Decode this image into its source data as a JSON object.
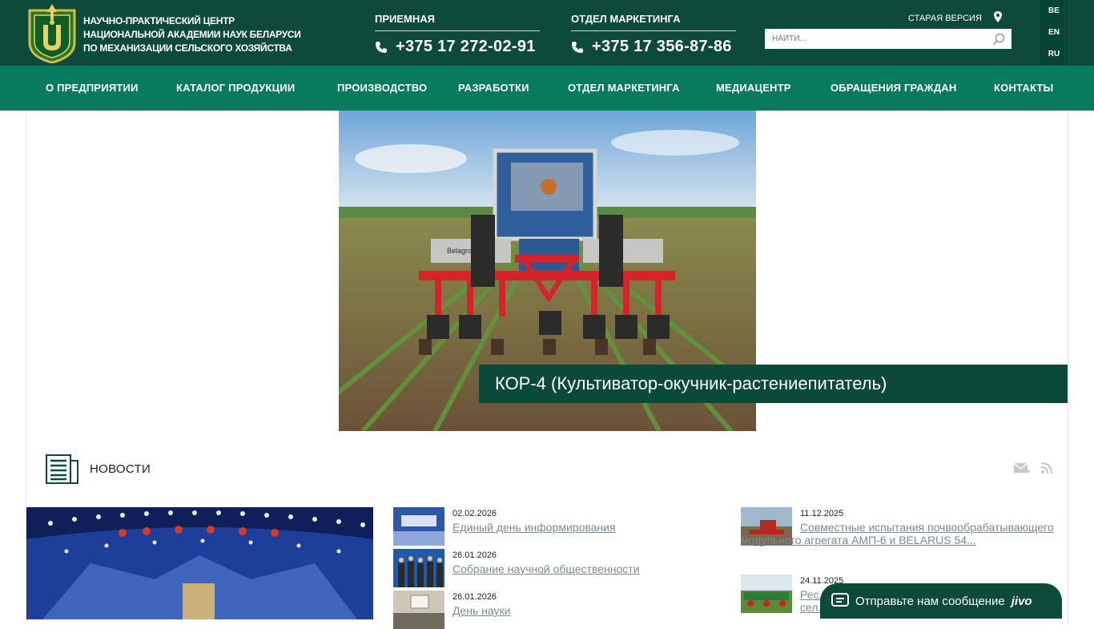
{
  "header": {
    "org_line1": "НАУЧНО-ПРАКТИЧЕСКИЙ ЦЕНТР",
    "org_line2": "НАЦИОНАЛЬНОЙ АКАДЕМИИ НАУК БЕЛАРУСИ",
    "org_line3": "ПО МЕХАНИЗАЦИИ СЕЛЬСКОГО ХОЗЯЙСТВА",
    "reception_title": "ПРИЕМНАЯ",
    "reception_phone": "+375 17 272-02-91",
    "marketing_title": "ОТДЕЛ МАРКЕТИНГА",
    "marketing_phone": "+375 17 356-87-86",
    "old_version": "СТАРАЯ ВЕРСИЯ",
    "search_placeholder": "НАЙТИ...",
    "languages": [
      "BE",
      "EN",
      "RU"
    ]
  },
  "nav": [
    "О ПРЕДПРИЯТИИ",
    "КАТАЛОГ ПРОДУКЦИИ",
    "ПРОИЗВОДСТВО",
    "РАЗРАБОТКИ",
    "ОТДЕЛ МАРКЕТИНГА",
    "МЕДИАЦЕНТР",
    "ОБРАЩЕНИЯ ГРАЖДАН",
    "КОНТАКТЫ"
  ],
  "hero": {
    "caption": "КОР-4 (Культиватор-окучник-растениепитатель)",
    "image_text": "Belagromech"
  },
  "news": {
    "title": "НОВОСТИ",
    "middle": [
      {
        "date": "02.02.2026",
        "title": "Единый день информирования"
      },
      {
        "date": "26.01.2026",
        "title": "Собрание научной общественности"
      },
      {
        "date": "26.01.2026",
        "title": "День науки"
      }
    ],
    "right": [
      {
        "date": "11.12.2025",
        "title": "Совместные испытания почвообрабатывающего модульного агрегата АМП-6 и BELARUS 54..."
      },
      {
        "date": "24.11.2025",
        "title": "Рес... сел..."
      }
    ]
  },
  "chat": {
    "text": "Отправьте нам сообщение",
    "brand": "jivo"
  },
  "colors": {
    "header_bg": "#0d4a3a",
    "nav_bg": "#087a5e",
    "caption_bg": "#0b4a3a",
    "link": "#7a8a96"
  }
}
